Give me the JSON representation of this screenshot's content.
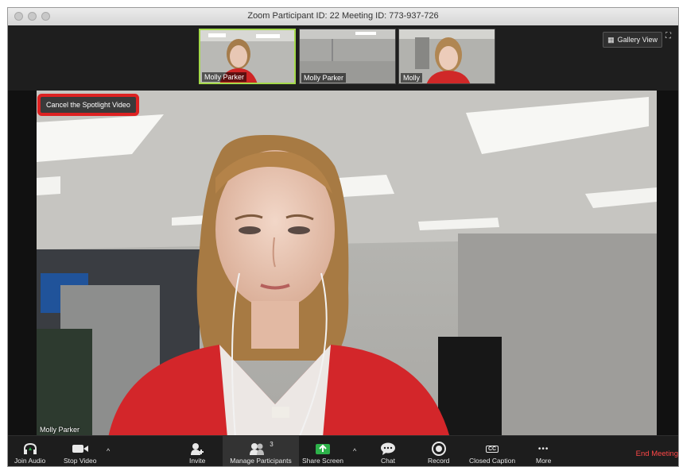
{
  "window": {
    "title": "Zoom Participant ID: 22   Meeting ID: 773-937-726"
  },
  "thumbnails": [
    {
      "name": "Molly Parker",
      "active": true
    },
    {
      "name": "Molly Parker",
      "active": false
    },
    {
      "name": "Molly",
      "active": false
    }
  ],
  "gallery_view_label": "Gallery View",
  "spotlight": {
    "cancel_label": "Cancel the Spotlight Video"
  },
  "video": {
    "participant_name": "Molly Parker"
  },
  "toolbar": {
    "join_audio": "Join Audio",
    "stop_video": "Stop Video",
    "invite": "Invite",
    "manage_participants": "Manage Participants",
    "participant_count": "3",
    "share_screen": "Share Screen",
    "chat": "Chat",
    "record": "Record",
    "closed_caption": "Closed Caption",
    "cc_badge": "CC",
    "more": "More",
    "more_dots": "•••",
    "end_meeting": "End Meeting"
  },
  "colors": {
    "spotlight_highlight": "#dd2222",
    "active_thumb_border": "#a4d94a",
    "share_green": "#2db24a",
    "end_red": "#ff4747"
  }
}
